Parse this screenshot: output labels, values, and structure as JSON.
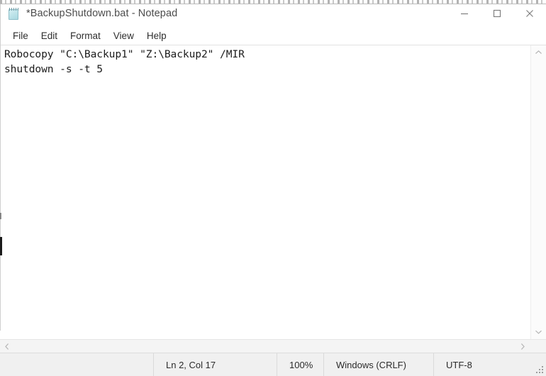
{
  "window": {
    "title": "*BackupShutdown.bat - Notepad",
    "icon": "notepad-icon",
    "controls": [
      {
        "name": "minimize-button",
        "label": "Minimize",
        "glyph": "minimize-icon"
      },
      {
        "name": "maximize-button",
        "label": "Maximize",
        "glyph": "maximize-icon"
      },
      {
        "name": "close-button",
        "label": "Close",
        "glyph": "close-icon"
      }
    ]
  },
  "menubar": {
    "items": [
      {
        "label": "File"
      },
      {
        "label": "Edit"
      },
      {
        "label": "Format"
      },
      {
        "label": "View"
      },
      {
        "label": "Help"
      }
    ]
  },
  "editor": {
    "lines": [
      "Robocopy \"C:\\Backup1\" \"Z:\\Backup2\" /MIR",
      "shutdown -s -t 5"
    ],
    "text_color": "#1c1c1c",
    "background": "#ffffff"
  },
  "scrollbars": {
    "vertical": {
      "up_arrow": "chevron-up-icon",
      "down_arrow": "chevron-down-icon"
    },
    "horizontal": {
      "left_arrow": "chevron-left-icon",
      "right_arrow": "chevron-right-icon"
    }
  },
  "statusbar": {
    "blank": "",
    "position": "Ln 2, Col 17",
    "zoom": "100%",
    "line_ending": "Windows (CRLF)",
    "encoding": "UTF-8",
    "background": "#f0f0f0"
  }
}
